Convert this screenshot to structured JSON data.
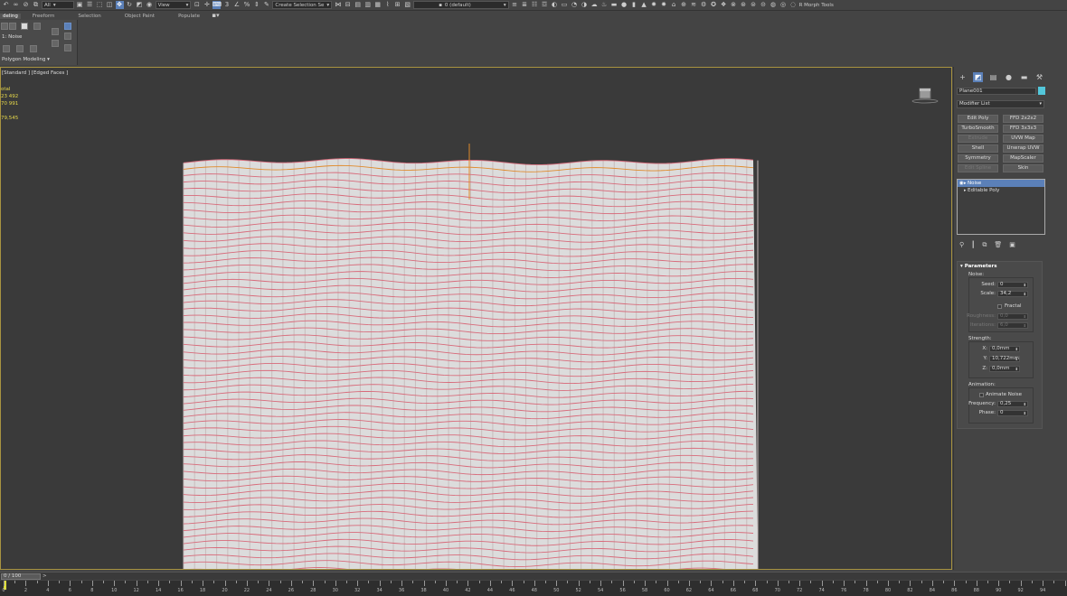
{
  "toolbar": {
    "selection_filter": "All",
    "ref_coord": "View",
    "named_selection": "Create Selection Se",
    "layer": "0 (default)",
    "morph_tools": "R Morph Tools"
  },
  "ribbon": {
    "tabs": [
      "deling",
      "Freeform",
      "Selection",
      "Object Paint",
      "Populate"
    ],
    "active_tab": "deling",
    "panel_label": "1: Noise",
    "panel_title": "Polygon Modeling"
  },
  "viewport": {
    "label": "[Standard ] [Edged Faces ]",
    "stats": [
      "otal",
      "23 492",
      "70 991",
      "",
      "79,545"
    ]
  },
  "command_panel": {
    "object_name": "Plane001",
    "object_color": "#53c7da",
    "modifier_list": "Modifier List",
    "modifier_buttons": [
      {
        "label": "Edit Poly",
        "enabled": true
      },
      {
        "label": "FFD 2x2x2",
        "enabled": true
      },
      {
        "label": "TurboSmooth",
        "enabled": true
      },
      {
        "label": "FFD 3x3x3",
        "enabled": true
      },
      {
        "label": "Extrude",
        "enabled": false
      },
      {
        "label": "UVW Map",
        "enabled": true
      },
      {
        "label": "Shell",
        "enabled": true
      },
      {
        "label": "Unwrap UVW",
        "enabled": true
      },
      {
        "label": "Symmetry",
        "enabled": true
      },
      {
        "label": "MapScaler",
        "enabled": true
      },
      {
        "label": "Edit Spline",
        "enabled": false
      },
      {
        "label": "Skin",
        "enabled": true
      }
    ],
    "stack": [
      {
        "label": "Noise",
        "selected": true
      },
      {
        "label": "Editable Poly",
        "selected": false
      }
    ]
  },
  "parameters": {
    "title": "Parameters",
    "noise_group": "Noise:",
    "seed_label": "Seed:",
    "seed_value": "0",
    "scale_label": "Scale:",
    "scale_value": "34,2",
    "fractal_label": "Fractal",
    "roughness_label": "Roughness:",
    "roughness_value": "0,0",
    "iterations_label": "Iterations:",
    "iterations_value": "6,0",
    "strength_group": "Strength:",
    "x_label": "X:",
    "x_value": "0,0mm",
    "y_label": "Y:",
    "y_value": "10,722mm",
    "z_label": "Z:",
    "z_value": "0,0mm",
    "animation_group": "Animation:",
    "animate_noise_label": "Animate Noise",
    "frequency_label": "Frequency:",
    "frequency_value": "0,25",
    "phase_label": "Phase:",
    "phase_value": "0"
  },
  "timeline": {
    "frame_display": "0 / 100",
    "next_symbol": ">",
    "tick_labels": [
      "0",
      "2",
      "4",
      "6",
      "8",
      "10",
      "12",
      "14",
      "16",
      "18",
      "20",
      "22",
      "24",
      "26",
      "28",
      "30",
      "32",
      "34",
      "36",
      "38",
      "40",
      "42",
      "44",
      "46",
      "48",
      "50",
      "52",
      "54",
      "56",
      "58",
      "60",
      "62",
      "64",
      "66",
      "68",
      "70",
      "72",
      "74",
      "76",
      "78",
      "80",
      "82",
      "84",
      "86",
      "88",
      "90",
      "92",
      "94",
      "96"
    ]
  }
}
